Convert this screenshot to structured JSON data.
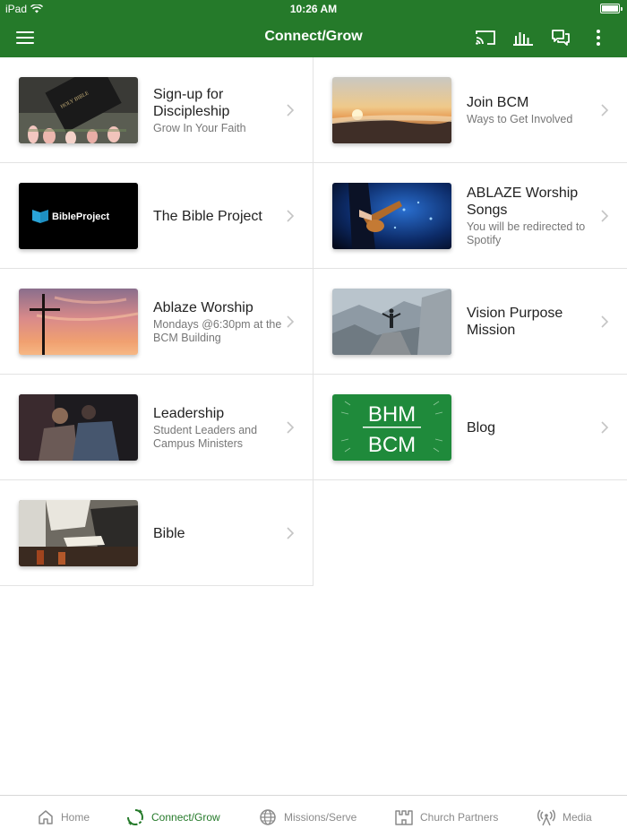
{
  "status_bar": {
    "carrier": "iPad",
    "time": "10:26 AM"
  },
  "app_bar": {
    "title": "Connect/Grow"
  },
  "colors": {
    "brand_green": "#257a2a",
    "inactive_grey": "#8a8a8a"
  },
  "items": [
    {
      "title": "Sign-up for Discipleship",
      "subtitle": "Grow In Your Faith",
      "thumb": "holy-bible-tulips"
    },
    {
      "title": "Join BCM",
      "subtitle": "Ways to Get Involved",
      "thumb": "sunrise-clouds"
    },
    {
      "title": "The Bible Project",
      "subtitle": "",
      "thumb": "bibleproject-logo",
      "thumb_text": "BibleProject"
    },
    {
      "title": "ABLAZE Worship Songs",
      "subtitle": "You will be redirected to Spotify",
      "thumb": "guitarist-concert"
    },
    {
      "title": "Ablaze Worship",
      "subtitle": "Mondays @6:30pm at the BCM Building",
      "thumb": "cross-sunset"
    },
    {
      "title": "Vision Purpose Mission",
      "subtitle": "",
      "thumb": "person-mountain-top"
    },
    {
      "title": "Leadership",
      "subtitle": "Student Leaders and Campus Ministers",
      "thumb": "men-praying"
    },
    {
      "title": "Blog",
      "subtitle": "",
      "thumb": "bhm-bcm-logo",
      "thumb_text_1": "BHM",
      "thumb_text_2": "BCM"
    },
    {
      "title": "Bible",
      "subtitle": "",
      "thumb": "reading-bible-table"
    }
  ],
  "tabs": [
    {
      "label": "Home",
      "icon": "home-icon",
      "active": false
    },
    {
      "label": "Connect/Grow",
      "icon": "connect-grow-icon",
      "active": true
    },
    {
      "label": "Missions/Serve",
      "icon": "globe-icon",
      "active": false
    },
    {
      "label": "Church Partners",
      "icon": "church-icon",
      "active": false
    },
    {
      "label": "Media",
      "icon": "broadcast-icon",
      "active": false
    }
  ]
}
